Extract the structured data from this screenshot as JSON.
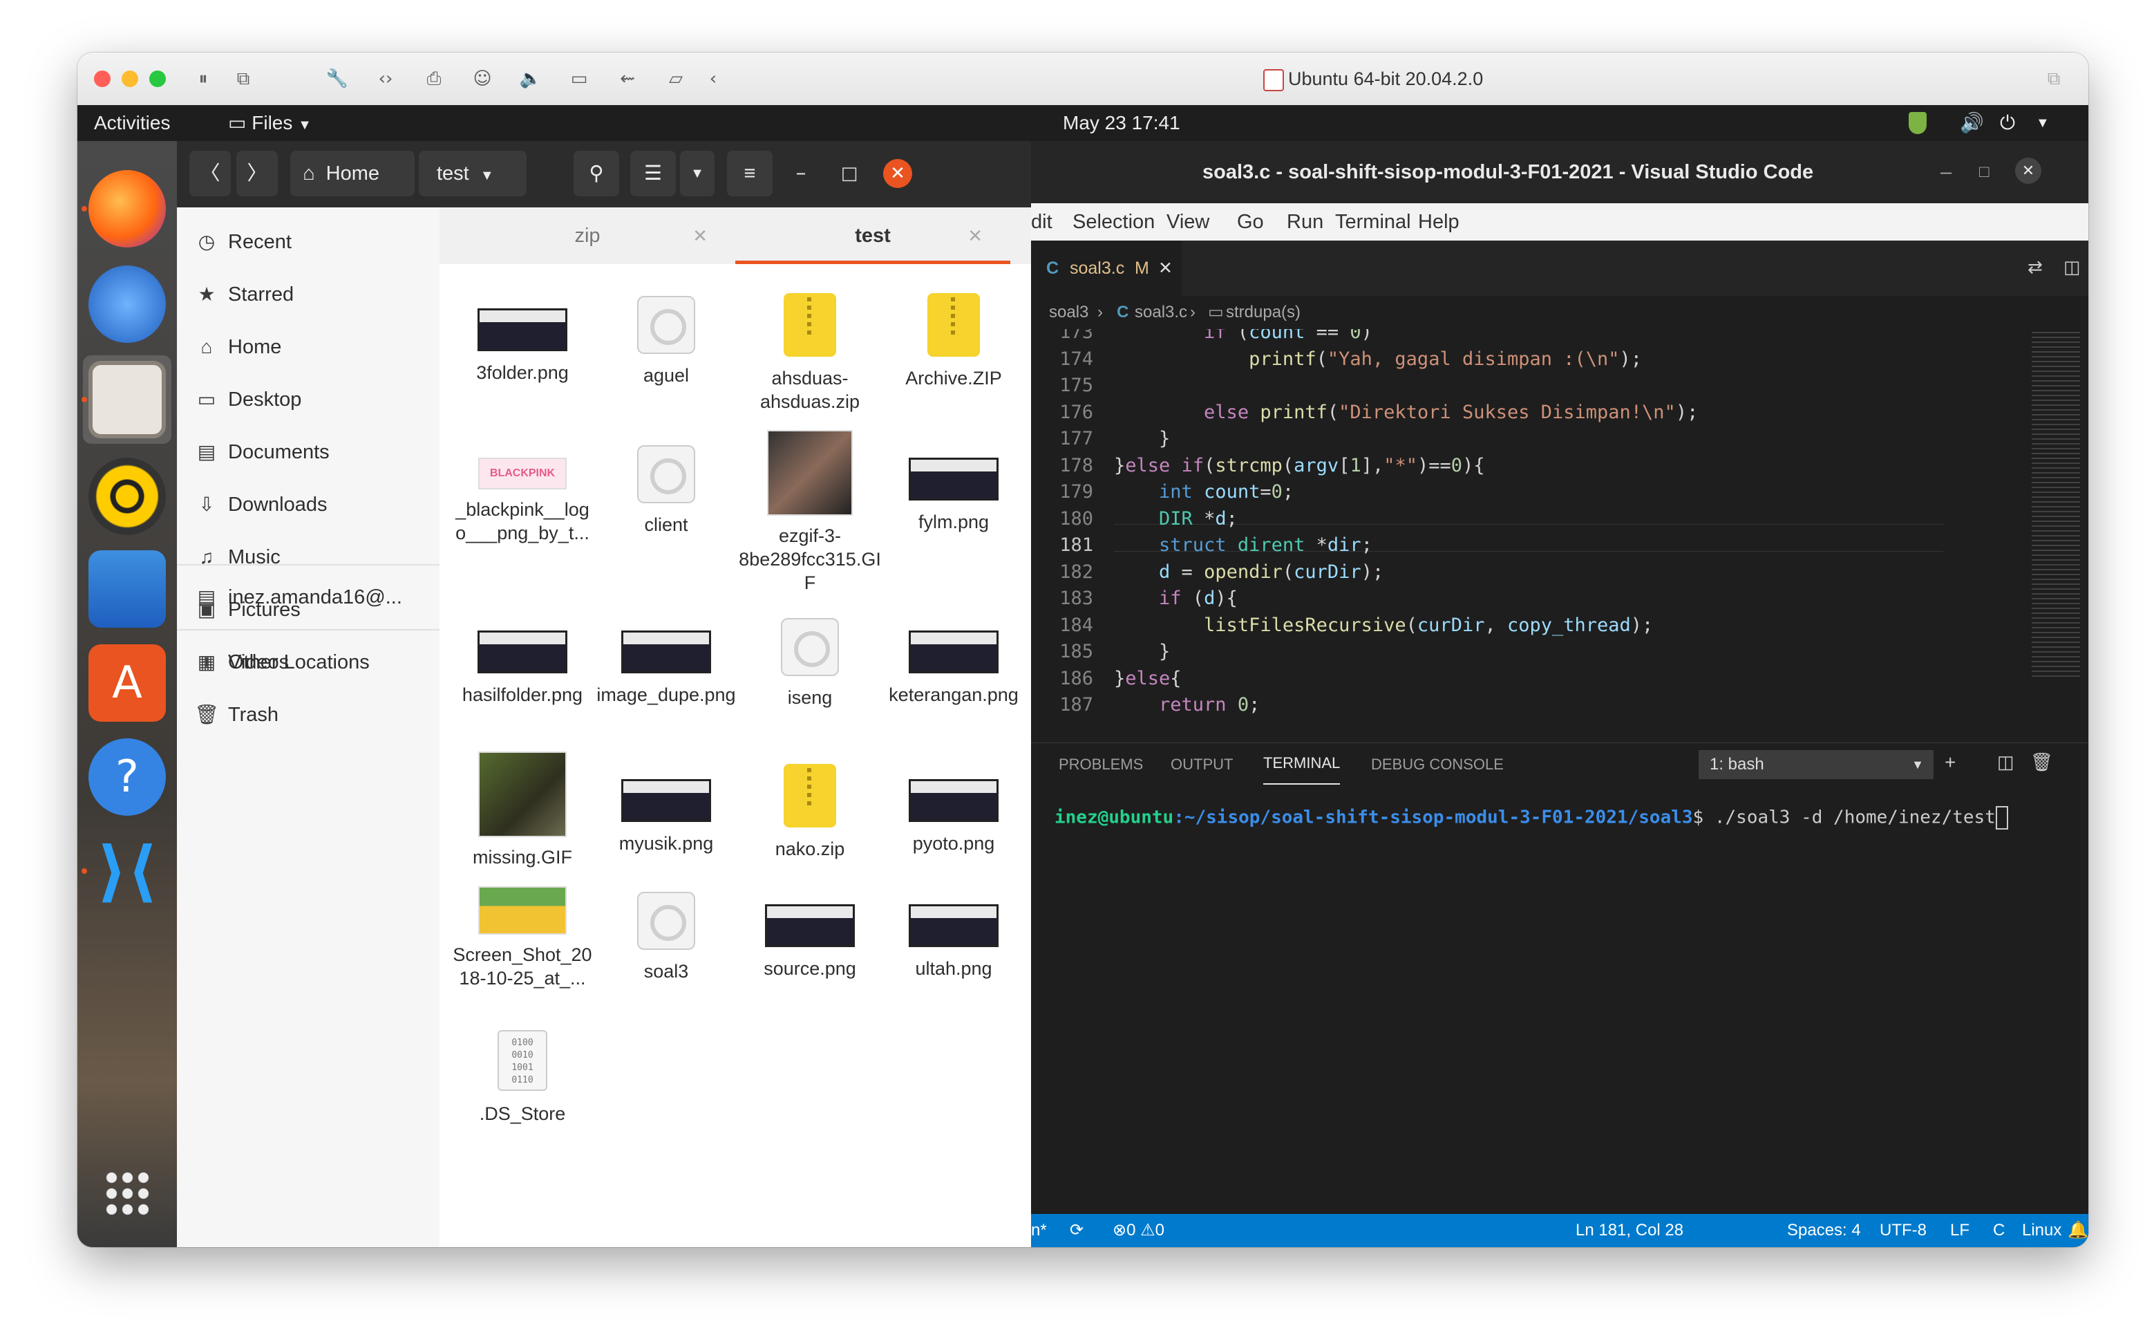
{
  "vm": {
    "title": "Ubuntu 64-bit 20.04.2.0",
    "toolbar_icons": [
      "pause-icon",
      "snapshot-icon",
      "wrench-icon",
      "code-icon",
      "printer-icon",
      "user-icon",
      "speaker-icon",
      "camera-icon",
      "usb-icon",
      "folder-share-icon",
      "chevron-left-icon"
    ]
  },
  "panel": {
    "activities": "Activities",
    "app_menu": "Files",
    "datetime": "May 23  17:41"
  },
  "files": {
    "path_home": "Home",
    "path_current": "test",
    "sidebar": [
      {
        "label": "Recent",
        "icon": "clock-icon"
      },
      {
        "label": "Starred",
        "icon": "star-icon"
      },
      {
        "label": "Home",
        "icon": "home-icon"
      },
      {
        "label": "Desktop",
        "icon": "desktop-icon"
      },
      {
        "label": "Documents",
        "icon": "document-icon"
      },
      {
        "label": "Downloads",
        "icon": "download-icon"
      },
      {
        "label": "Music",
        "icon": "music-icon"
      },
      {
        "label": "Pictures",
        "icon": "picture-icon"
      },
      {
        "label": "Videos",
        "icon": "video-icon"
      },
      {
        "label": "Trash",
        "icon": "trash-icon"
      }
    ],
    "network": "inez.amanda16@...",
    "other_locations": "Other Locations",
    "tabs": [
      "zip",
      "test"
    ],
    "items": [
      {
        "name": "3folder.png",
        "kind": "image"
      },
      {
        "name": "aguel",
        "kind": "exec"
      },
      {
        "name": "ahsduas-ahsduas.zip",
        "kind": "zip"
      },
      {
        "name": "Archive.ZIP",
        "kind": "zip"
      },
      {
        "name": "_blackpink__logo___png_by_t...",
        "kind": "logo"
      },
      {
        "name": "client",
        "kind": "exec"
      },
      {
        "name": "ezgif-3-8be289fcc315.GIF",
        "kind": "photo"
      },
      {
        "name": "fylm.png",
        "kind": "image"
      },
      {
        "name": "hasilfolder.png",
        "kind": "image"
      },
      {
        "name": "image_dupe.png",
        "kind": "image"
      },
      {
        "name": "iseng",
        "kind": "exec"
      },
      {
        "name": "keterangan.png",
        "kind": "image"
      },
      {
        "name": "missing.GIF",
        "kind": "photo2"
      },
      {
        "name": "myusik.png",
        "kind": "image"
      },
      {
        "name": "nako.zip",
        "kind": "zip"
      },
      {
        "name": "pyoto.png",
        "kind": "image"
      },
      {
        "name": "Screen_Shot_2018-10-25_at_...",
        "kind": "pika"
      },
      {
        "name": "soal3",
        "kind": "exec"
      },
      {
        "name": "source.png",
        "kind": "image"
      },
      {
        "name": "ultah.png",
        "kind": "image"
      },
      {
        "name": ".DS_Store",
        "kind": "binary"
      }
    ]
  },
  "vscode": {
    "title": "soal3.c - soal-shift-sisop-modul-3-F01-2021 - Visual Studio Code",
    "menu": [
      "dit",
      "Selection",
      "View",
      "Go",
      "Run",
      "Terminal",
      "Help"
    ],
    "tab": {
      "lang": "C",
      "name": "soal3.c",
      "status": "M"
    },
    "breadcrumb": [
      "soal3",
      "soal3.c",
      "strdupa(s)"
    ],
    "lines": [
      {
        "n": "173",
        "code": "        if (count == 0)"
      },
      {
        "n": "174",
        "code": "            printf(\"Yah, gagal disimpan :(\\n\");"
      },
      {
        "n": "175",
        "code": ""
      },
      {
        "n": "176",
        "code": "        else printf(\"Direktori Sukses Disimpan!\\n\");"
      },
      {
        "n": "177",
        "code": "    }"
      },
      {
        "n": "178",
        "code": "}else if(strcmp(argv[1],\"*\")==0){"
      },
      {
        "n": "179",
        "code": "    int count=0;"
      },
      {
        "n": "180",
        "code": "    DIR *d;"
      },
      {
        "n": "181",
        "code": "    struct dirent *dir;"
      },
      {
        "n": "182",
        "code": "    d = opendir(curDir);"
      },
      {
        "n": "183",
        "code": "    if (d){"
      },
      {
        "n": "184",
        "code": "        listFilesRecursive(curDir, copy_thread);"
      },
      {
        "n": "185",
        "code": "    }"
      },
      {
        "n": "186",
        "code": "}else{"
      },
      {
        "n": "187",
        "code": "    return 0;"
      }
    ],
    "panel_tabs": [
      "PROBLEMS",
      "OUTPUT",
      "TERMINAL",
      "DEBUG CONSOLE"
    ],
    "terminal_select": "1: bash",
    "prompt_user": "inez@ubuntu",
    "prompt_path": ":~/sisop/soal-shift-sisop-modul-3-F01-2021/soal3",
    "prompt_cmd": "$ ./soal3 -d /home/inez/test",
    "status": {
      "branch": "n*",
      "problems": "0",
      "warnings": "0",
      "position": "Ln 181, Col 28",
      "spaces": "Spaces: 4",
      "encoding": "UTF-8",
      "eol": "LF",
      "language": "C",
      "os": "Linux"
    }
  },
  "colors": {
    "ubuntu_orange": "#e95420",
    "vscode_blue": "#007acc",
    "zip_yellow": "#f6d32d"
  }
}
